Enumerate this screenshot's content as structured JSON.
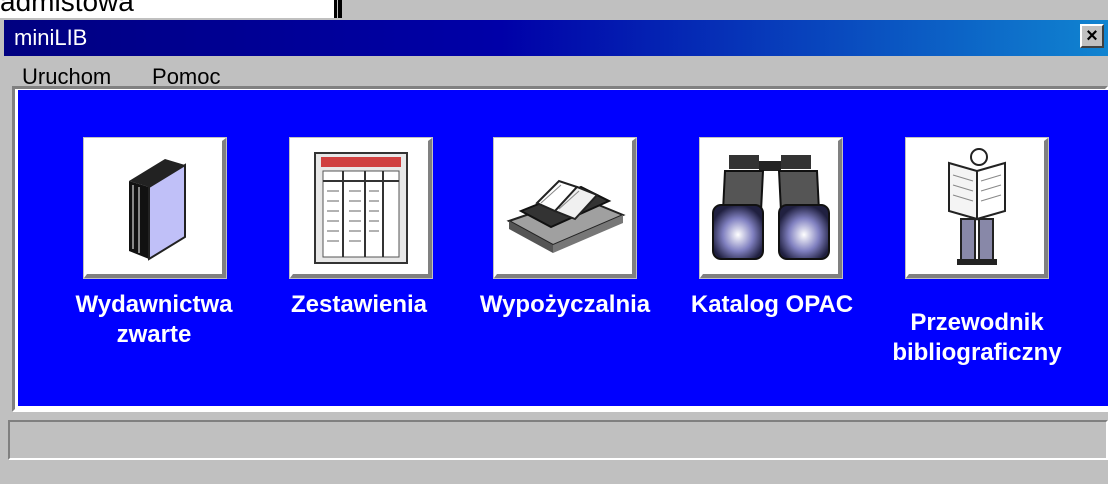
{
  "window": {
    "title": "miniLIB",
    "close_label": "×"
  },
  "menu": [
    {
      "accel": "U",
      "rest": "ruchom"
    },
    {
      "accel": "P",
      "rest": "omoc"
    }
  ],
  "modules": [
    {
      "label_line1": "Wydawnictwa",
      "label_line2": "zwarte",
      "icon": "book-icon"
    },
    {
      "label_line1": "Zestawienia",
      "label_line2": "",
      "icon": "report-sheet-icon"
    },
    {
      "label_line1": "Wypożyczalnia",
      "label_line2": "",
      "icon": "open-book-stack-icon"
    },
    {
      "label_line1": "Katalog OPAC",
      "label_line2": "",
      "icon": "binoculars-icon"
    },
    {
      "label_line1": "Przewodnik",
      "label_line2": "bibliograficzny",
      "icon": "reading-person-icon"
    }
  ],
  "status": {
    "text": ""
  },
  "colors": {
    "panel": "#0000ff",
    "title_start": "#000080",
    "title_end": "#1084d0"
  }
}
